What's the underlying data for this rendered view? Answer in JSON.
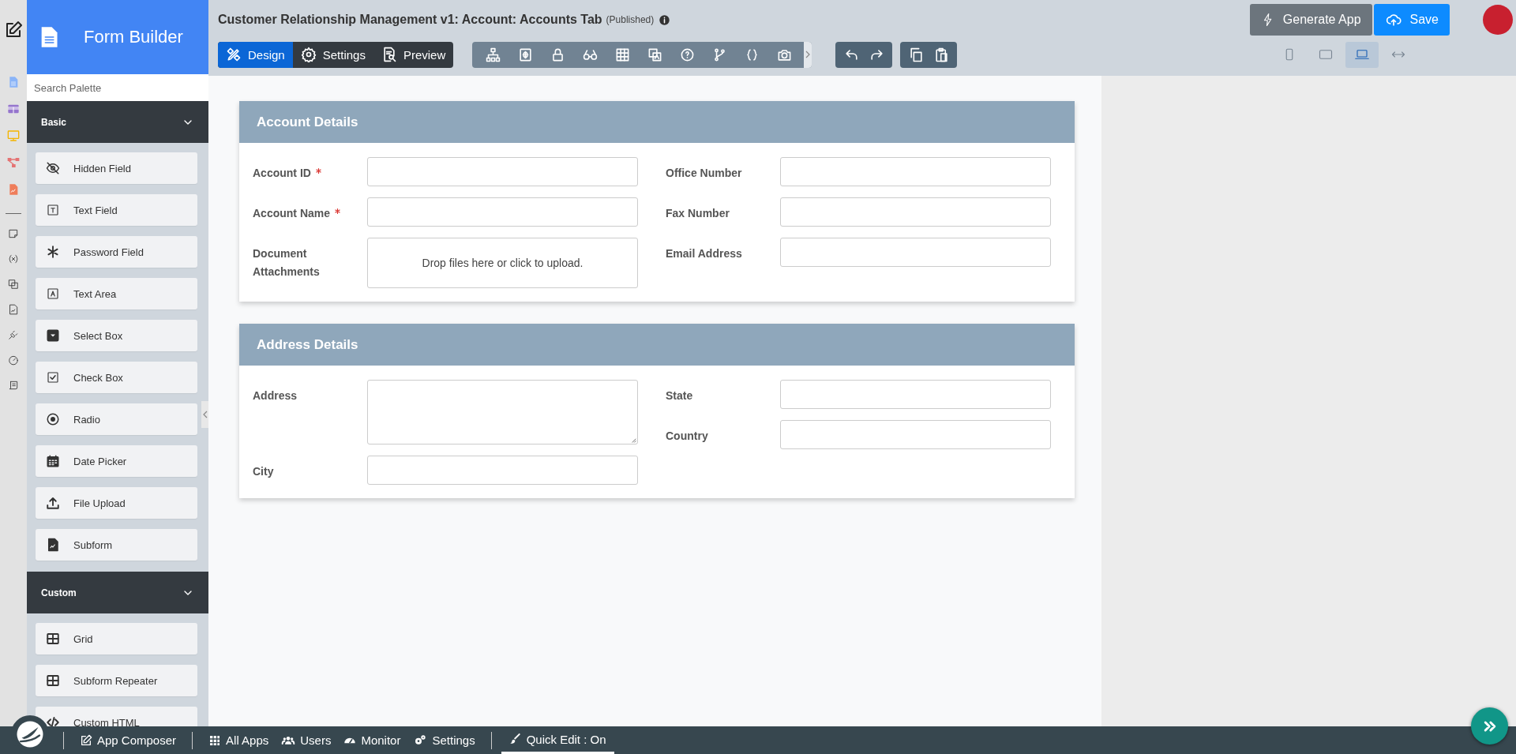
{
  "sidebar": {
    "title": "Form Builder",
    "search": {
      "placeholder": "Search Palette"
    },
    "sections": [
      {
        "title": "Basic",
        "expanded": true,
        "items": [
          {
            "label": "Hidden Field",
            "kind": "hidden"
          },
          {
            "label": "Text Field",
            "kind": "text"
          },
          {
            "label": "Password Field",
            "kind": "password"
          },
          {
            "label": "Text Area",
            "kind": "textarea"
          },
          {
            "label": "Select Box",
            "kind": "select"
          },
          {
            "label": "Check Box",
            "kind": "checkbox"
          },
          {
            "label": "Radio",
            "kind": "radio"
          },
          {
            "label": "Date Picker",
            "kind": "date"
          },
          {
            "label": "File Upload",
            "kind": "upload"
          },
          {
            "label": "Subform",
            "kind": "subform"
          }
        ]
      },
      {
        "title": "Custom",
        "expanded": true,
        "items": [
          {
            "label": "Grid",
            "kind": "grid"
          },
          {
            "label": "Subform Repeater",
            "kind": "grid"
          },
          {
            "label": "Custom HTML",
            "kind": "html"
          }
        ]
      }
    ]
  },
  "header": {
    "title": "Customer Relationship Management v1: Account: Accounts Tab",
    "status": "(Published)",
    "mode_tabs": [
      {
        "label": "Design",
        "selected": true
      },
      {
        "label": "Settings",
        "selected": false
      },
      {
        "label": "Preview",
        "selected": false
      }
    ],
    "buttons": [
      {
        "label": "Generate App",
        "kind": "generate"
      },
      {
        "label": "Save",
        "kind": "save"
      }
    ],
    "devices": [
      {
        "kind": "phone",
        "selected": false
      },
      {
        "kind": "tablet",
        "selected": false
      },
      {
        "kind": "laptop",
        "selected": true
      },
      {
        "kind": "full",
        "selected": false
      }
    ]
  },
  "form": {
    "sections": [
      {
        "title": "Account Details",
        "columns": [
          [
            {
              "label": "Account ID",
              "required": true,
              "kind": "text"
            },
            {
              "label": "Account Name",
              "required": true,
              "kind": "text"
            },
            {
              "label": "Document Attachments",
              "required": false,
              "kind": "upload",
              "prompt": "Drop files here or click to upload."
            }
          ],
          [
            {
              "label": "Office Number",
              "required": false,
              "kind": "text"
            },
            {
              "label": "Fax Number",
              "required": false,
              "kind": "text"
            },
            {
              "label": "Email Address",
              "required": false,
              "kind": "text"
            }
          ]
        ]
      },
      {
        "title": "Address Details",
        "columns": [
          [
            {
              "label": "Address",
              "required": false,
              "kind": "textarea"
            },
            {
              "label": "City",
              "required": false,
              "kind": "text"
            }
          ],
          [
            {
              "label": "State",
              "required": false,
              "kind": "text"
            },
            {
              "label": "Country",
              "required": false,
              "kind": "text"
            }
          ]
        ]
      }
    ]
  },
  "bottom_bar": {
    "items": [
      {
        "label": "App Composer",
        "kind": "composer"
      },
      {
        "label": "All Apps",
        "kind": "apps"
      },
      {
        "label": "Users",
        "kind": "users"
      },
      {
        "label": "Monitor",
        "kind": "monitor"
      },
      {
        "label": "Settings",
        "kind": "settings"
      }
    ],
    "quick_edit": {
      "label": "Quick Edit : On",
      "on": true
    }
  }
}
